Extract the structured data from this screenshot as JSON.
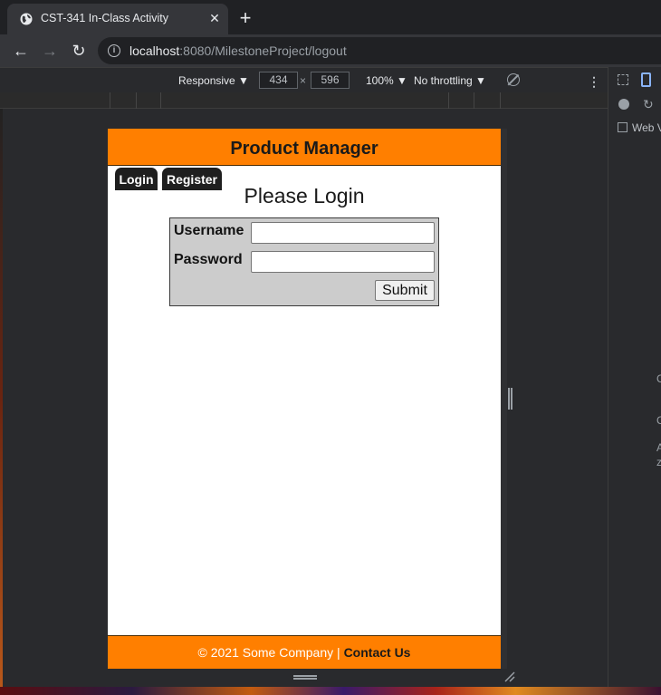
{
  "browser": {
    "tab_title": "CST-341 In-Class Activity",
    "close_tab": "✕",
    "new_tab": "+",
    "url_host": "localhost",
    "url_path": ":8080/MilestoneProject/logout"
  },
  "devtools": {
    "device": "Responsive ▼",
    "width": "434",
    "height": "596",
    "times": "×",
    "zoom": "100% ▼",
    "throttle": "No throttling ▼",
    "side_label": "Web V",
    "side_letters": [
      "C",
      "C",
      "A",
      "z"
    ]
  },
  "app": {
    "title": "Product Manager",
    "menu": [
      "Login",
      "Register"
    ],
    "heading": "Please Login",
    "form": {
      "username_label": "Username",
      "password_label": "Password",
      "username_value": "",
      "password_value": "",
      "submit_label": "Submit"
    },
    "footer": {
      "copyright": "© 2021 Some Company | ",
      "contact": "Contact Us"
    },
    "colors": {
      "header_bg": "#ff7f00",
      "menu_bg": "#1f1f1f",
      "form_bg": "#cccccc"
    }
  }
}
